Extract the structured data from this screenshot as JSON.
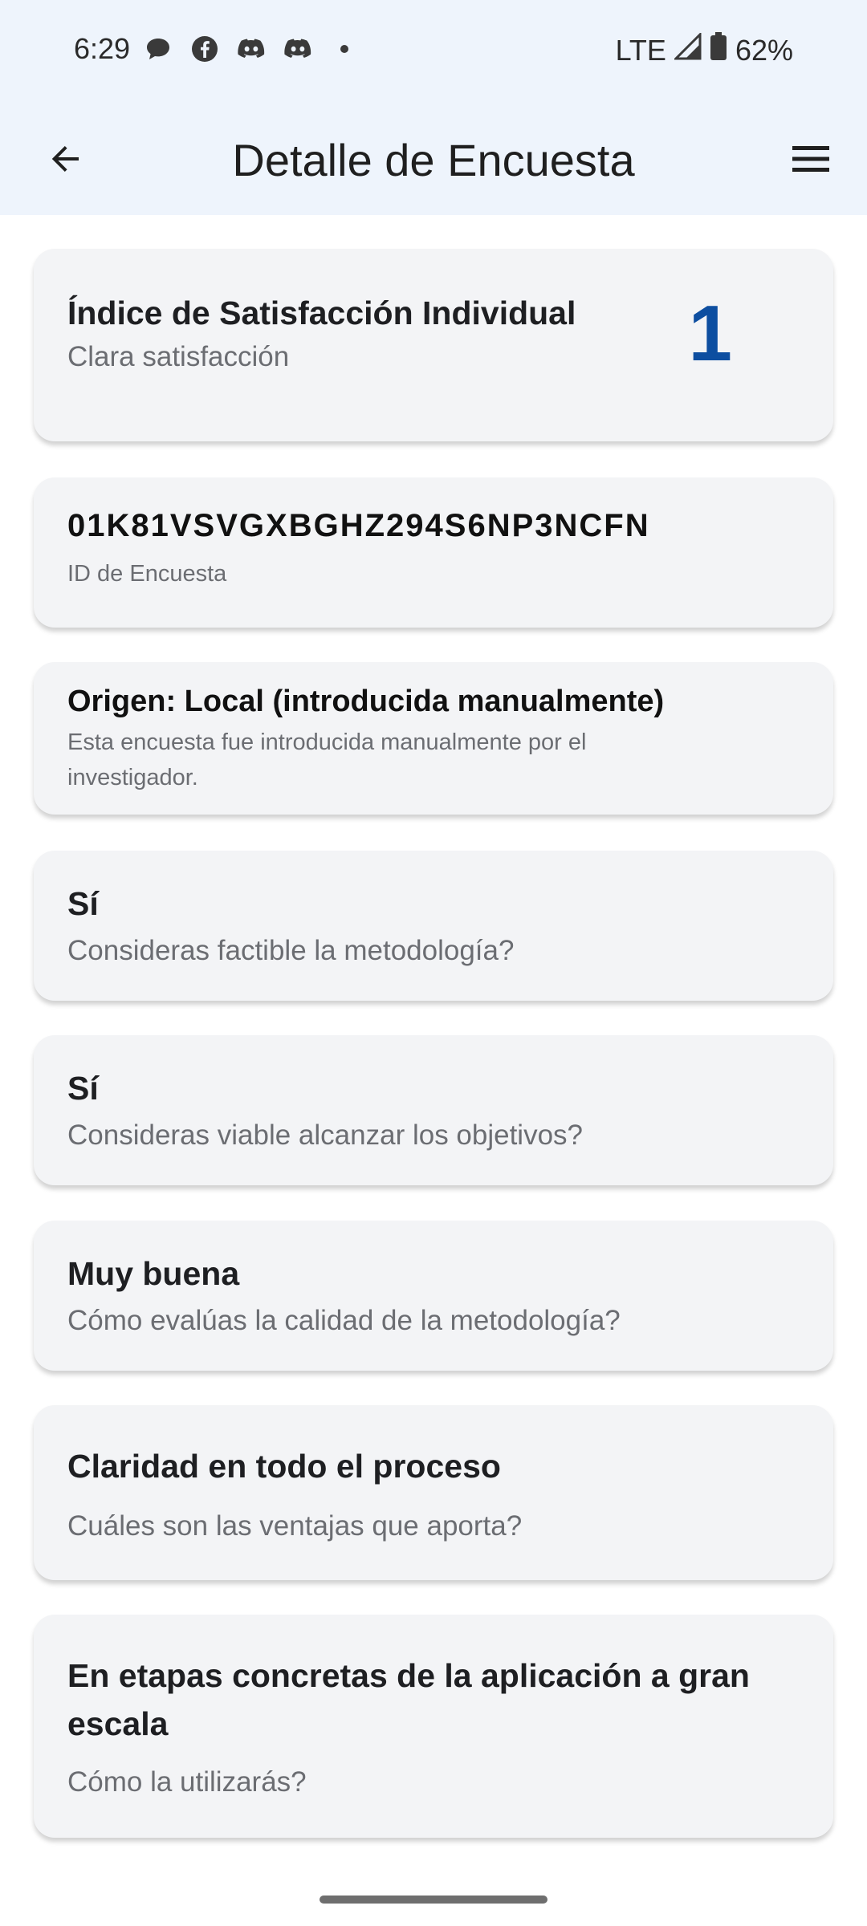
{
  "status_bar": {
    "time": "6:29",
    "network": "LTE",
    "battery": "62%",
    "icons": [
      "message-icon",
      "facebook-icon",
      "discord-icon",
      "discord-icon",
      "dot-icon"
    ]
  },
  "app_bar": {
    "title": "Detalle de Encuesta",
    "back_icon": "arrow-left-icon",
    "menu_icon": "hamburger-menu-icon"
  },
  "colors": {
    "app_bar_bg": "#eef4fc",
    "card_bg": "#f3f4f6",
    "accent": "#0d4ea0"
  },
  "satisfaction": {
    "title": "Índice de Satisfacción Individual",
    "subtitle": "Clara satisfacción",
    "value": "1"
  },
  "survey_id": {
    "value": "01K81VSVGXBGHZ294S6NP3NCFN",
    "label": "ID de Encuesta"
  },
  "origin": {
    "title": "Origen: Local (introducida manualmente)",
    "description": "Esta encuesta fue introducida manualmente por el investigador."
  },
  "answers": [
    {
      "answer": "Sí",
      "question": "Consideras factible la metodología?"
    },
    {
      "answer": "Sí",
      "question": "Consideras viable alcanzar los objetivos?"
    },
    {
      "answer": "Muy buena",
      "question": "Cómo evalúas la calidad de la metodología?"
    },
    {
      "answer": "Claridad en todo el proceso",
      "question": "Cuáles son las ventajas que aporta?"
    },
    {
      "answer": "En etapas concretas de la aplicación a gran escala",
      "question": "Cómo la utilizarás?"
    }
  ]
}
